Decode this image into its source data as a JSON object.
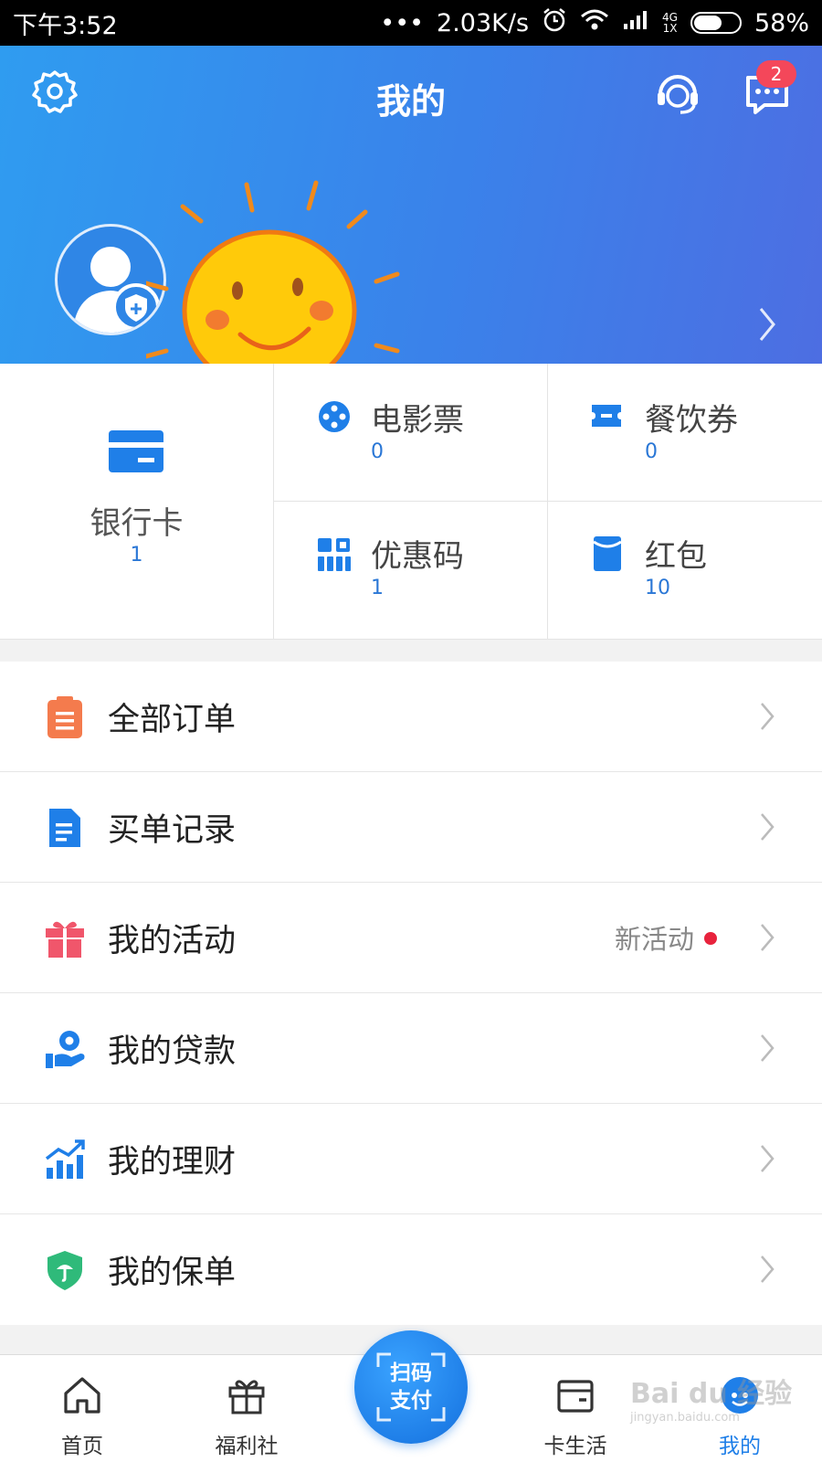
{
  "status_bar": {
    "time": "下午3:52",
    "dots": "•••",
    "speed": "2.03K/s",
    "network_top": "4G",
    "network_bottom": "1X",
    "battery": "58%"
  },
  "header": {
    "title": "我的",
    "message_badge": "2"
  },
  "quick_grid": {
    "bank_card": {
      "label": "银行卡",
      "count": "1"
    },
    "items": [
      {
        "label": "电影票",
        "count": "0"
      },
      {
        "label": "餐饮券",
        "count": "0"
      },
      {
        "label": "优惠码",
        "count": "1"
      },
      {
        "label": "红包",
        "count": "10"
      }
    ]
  },
  "menu": {
    "items": [
      {
        "label": "全部订单"
      },
      {
        "label": "买单记录"
      },
      {
        "label": "我的活动",
        "hint": "新活动"
      },
      {
        "label": "我的贷款"
      },
      {
        "label": "我的理财"
      },
      {
        "label": "我的保单"
      }
    ]
  },
  "bottom_nav": {
    "home": "首页",
    "welfare": "福利社",
    "scan_line1": "扫码",
    "scan_line2": "支付",
    "card_life": "卡生活",
    "mine": "我的"
  },
  "watermark": {
    "brand": "Bai du 经验",
    "url": "jingyan.baidu.com"
  },
  "colors": {
    "header_start": "#2f9cf0",
    "header_end": "#4d6ee2",
    "accent_blue": "#1f7fe8",
    "count_blue": "#2a77d6",
    "badge_red": "#f4475a",
    "order_orange": "#f47b4d",
    "gift_pink": "#f0566b",
    "shield_green": "#2fba7a"
  }
}
